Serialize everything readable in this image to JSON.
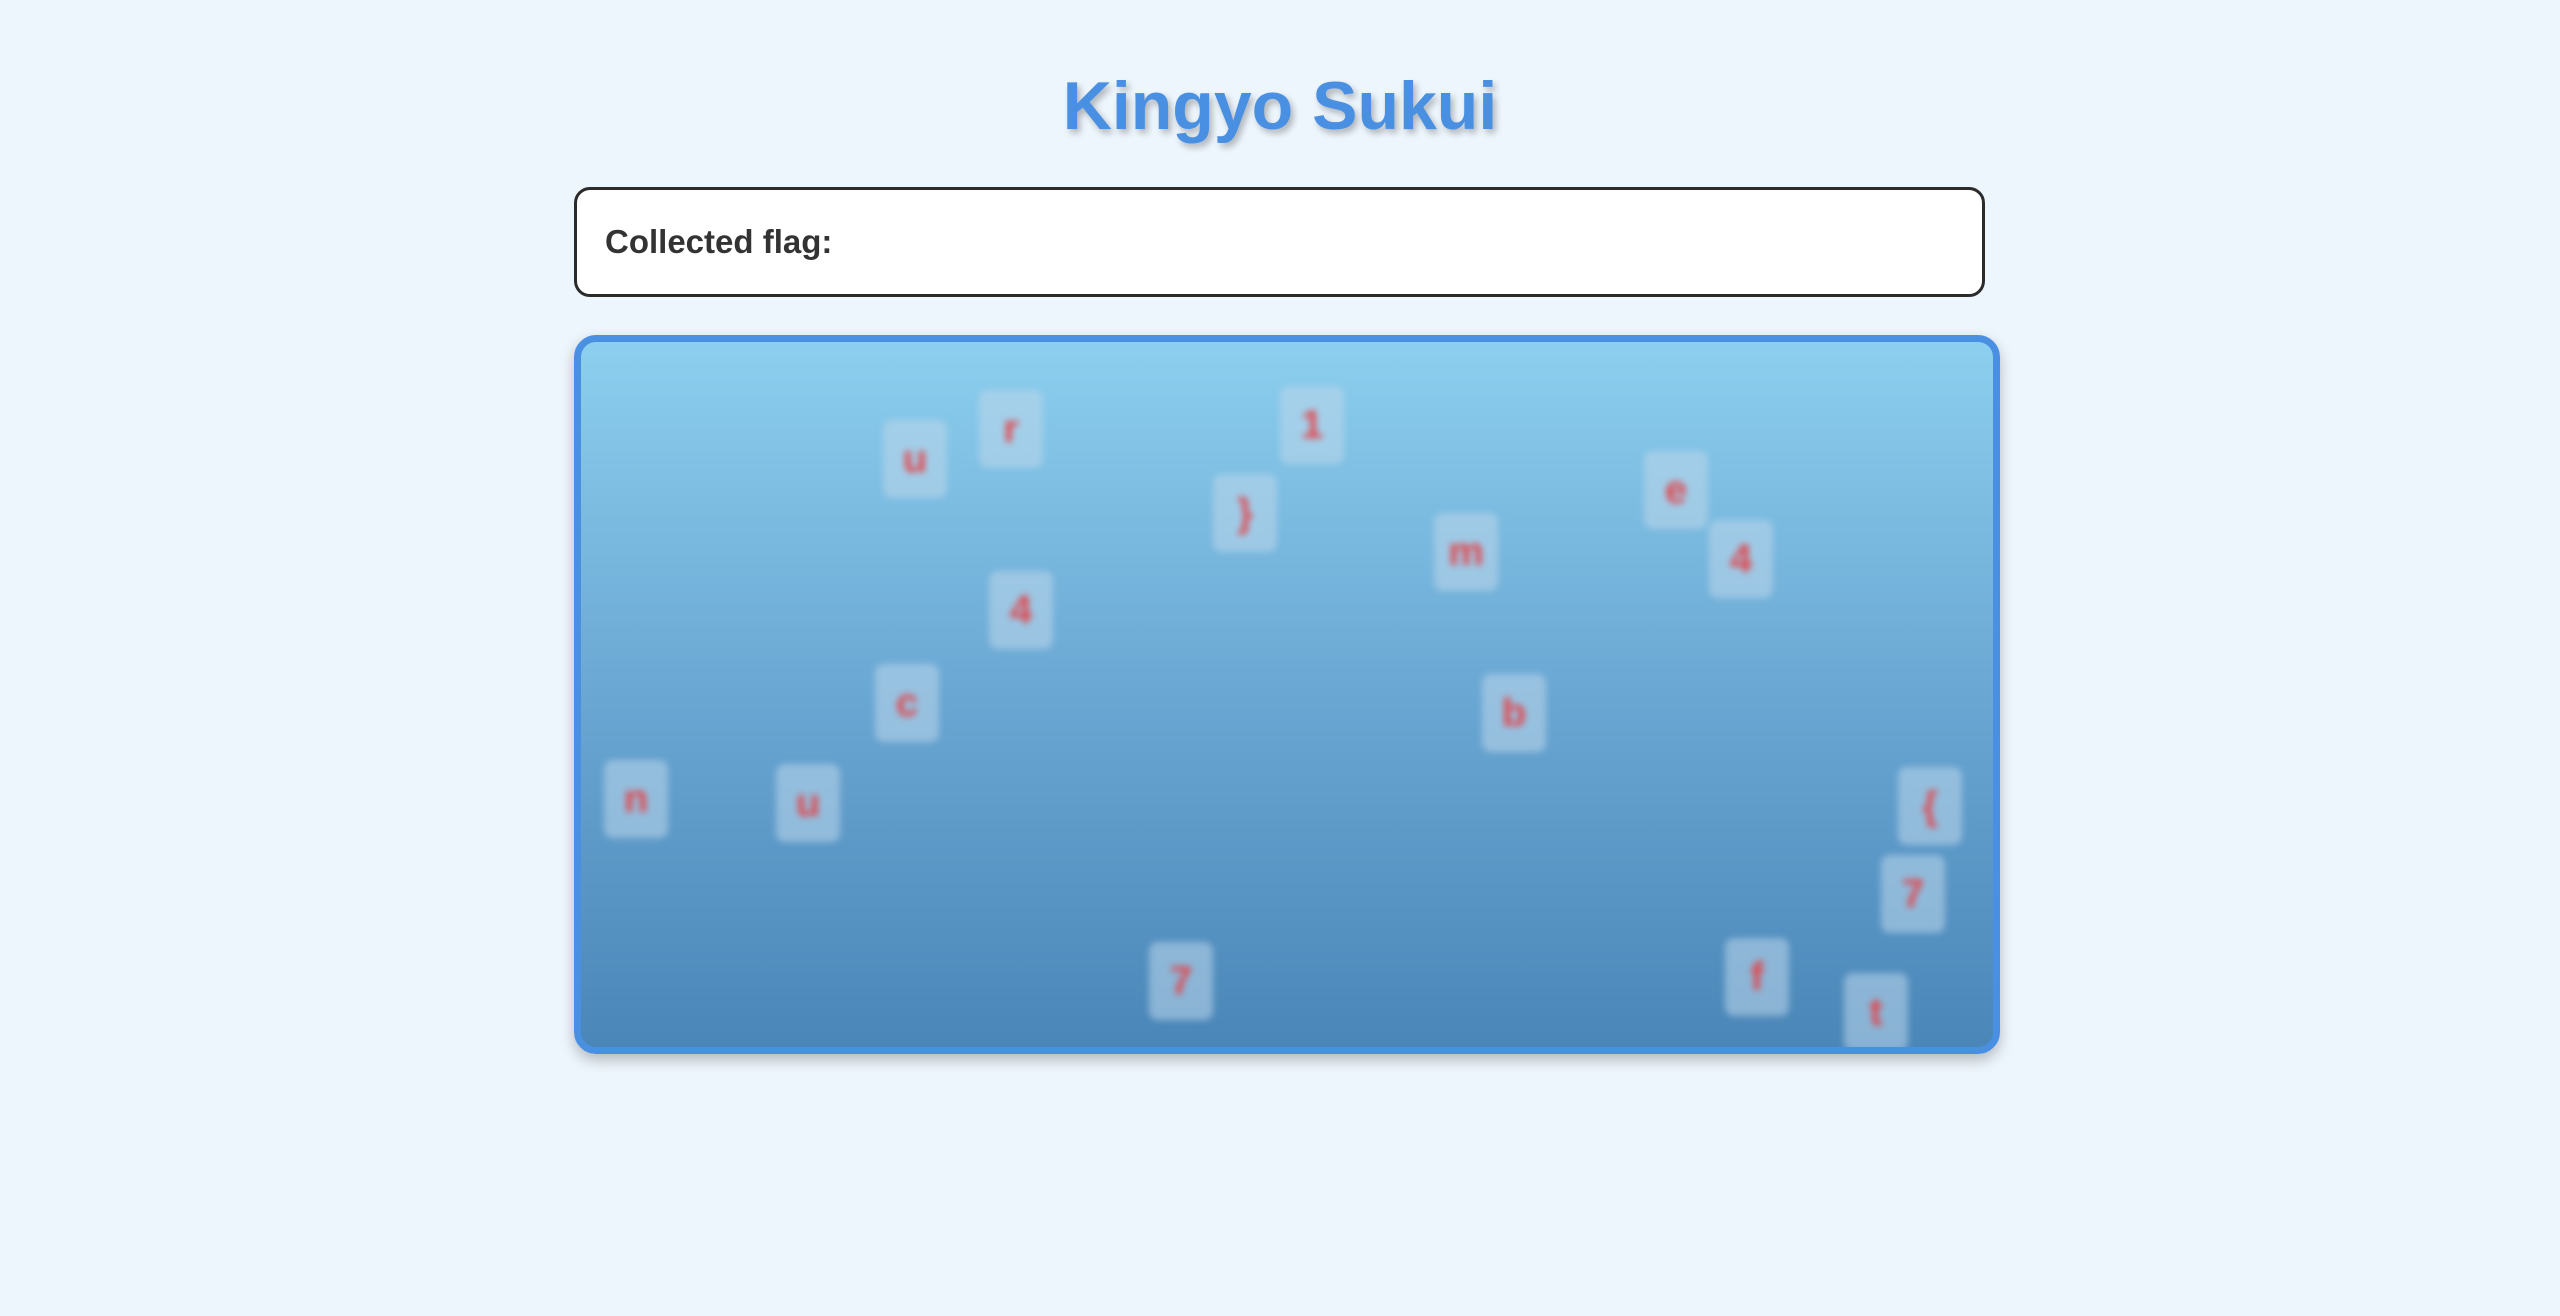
{
  "title": "Kingyo Sukui",
  "flag_panel": {
    "label": "Collected flag:",
    "value": ""
  },
  "pond": {
    "fish": [
      {
        "char": "u"
      },
      {
        "char": "r"
      },
      {
        "char": "1"
      },
      {
        "char": "}"
      },
      {
        "char": "m"
      },
      {
        "char": "e"
      },
      {
        "char": "4"
      },
      {
        "char": "4"
      },
      {
        "char": "c"
      },
      {
        "char": "b"
      },
      {
        "char": "n"
      },
      {
        "char": "u"
      },
      {
        "char": "{"
      },
      {
        "char": "7"
      },
      {
        "char": "7"
      },
      {
        "char": "f"
      },
      {
        "char": "t"
      }
    ]
  },
  "colors": {
    "accent": "#4a90e2",
    "fish_text": "#e0474c",
    "background": "#eef6fd"
  }
}
